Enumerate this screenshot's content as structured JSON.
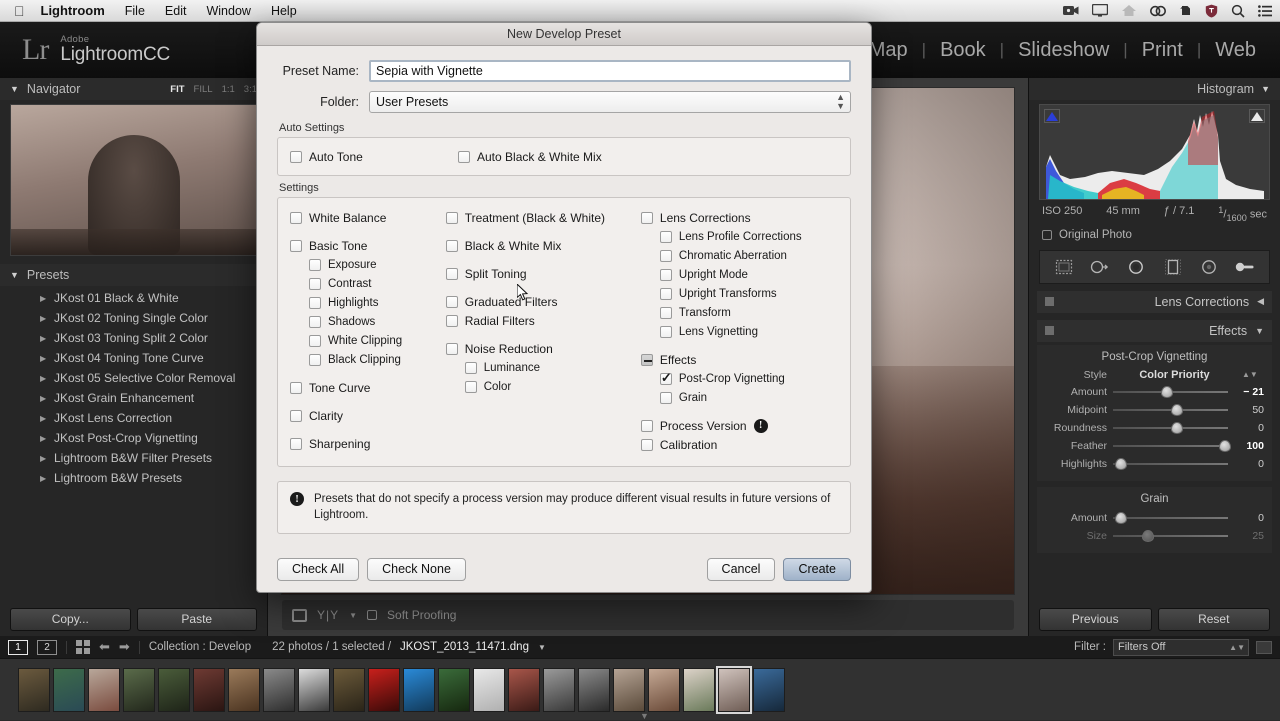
{
  "menubar": {
    "apple": "",
    "items": [
      "Lightroom",
      "File",
      "Edit",
      "Window",
      "Help"
    ],
    "status_icons": [
      "video-camera-icon",
      "display-icon",
      "dropbox-icon",
      "creative-cloud-icon",
      "evernote-icon",
      "shield-icon",
      "search-icon",
      "list-icon"
    ]
  },
  "app": {
    "brand_small": "Adobe",
    "brand_name": "LightroomCC",
    "logo": "Lr",
    "modules": [
      "Map",
      "Book",
      "Slideshow",
      "Print",
      "Web"
    ]
  },
  "navigator": {
    "title": "Navigator",
    "zoom_levels": [
      "FIT",
      "FILL",
      "1:1",
      "3:1"
    ],
    "active_zoom": "FIT"
  },
  "presets": {
    "title": "Presets",
    "items": [
      "JKost 01 Black & White",
      "JKost 02 Toning Single Color",
      "JKost 03 Toning Split 2 Color",
      "JKost 04 Toning Tone Curve",
      "JKost 05 Selective Color Removal",
      "JKost Grain Enhancement",
      "JKost Lens Correction",
      "JKost Post-Crop Vignetting",
      "Lightroom B&W Filter Presets",
      "Lightroom B&W Presets"
    ],
    "copy_label": "Copy...",
    "paste_label": "Paste"
  },
  "center": {
    "soft_proofing_label": "Soft Proofing"
  },
  "histogram": {
    "title": "Histogram",
    "iso": "ISO 250",
    "focal": "45 mm",
    "aperture": "ƒ / 7.1",
    "shutter_num": "1",
    "shutter_den": "1600",
    "shutter_unit": "sec",
    "original_photo": "Original Photo"
  },
  "panels": {
    "lens_corrections": "Lens Corrections",
    "effects": "Effects"
  },
  "effects": {
    "pcv_title": "Post-Crop Vignetting",
    "style_label": "Style",
    "style_value": "Color Priority",
    "sliders": [
      {
        "label": "Amount",
        "value": "− 21",
        "pos": 42,
        "bold": true
      },
      {
        "label": "Midpoint",
        "value": "50",
        "pos": 50,
        "bold": false
      },
      {
        "label": "Roundness",
        "value": "0",
        "pos": 50,
        "bold": false
      },
      {
        "label": "Feather",
        "value": "100",
        "pos": 92,
        "bold": true
      },
      {
        "label": "Highlights",
        "value": "0",
        "pos": 3,
        "bold": false
      }
    ],
    "grain_title": "Grain",
    "grain_sliders": [
      {
        "label": "Amount",
        "value": "0",
        "pos": 3,
        "dim": false
      },
      {
        "label": "Size",
        "value": "25",
        "pos": 25,
        "dim": true
      }
    ],
    "previous_label": "Previous",
    "reset_label": "Reset"
  },
  "toolbar": {
    "screen_1": "1",
    "screen_2": "2",
    "collection": "Collection : Develop",
    "photo_count": "22 photos / 1 selected /",
    "filename": "JKOST_2013_11471.dng",
    "filter_label": "Filter :",
    "filter_value": "Filters Off"
  },
  "dialog": {
    "title": "New Develop Preset",
    "preset_name_label": "Preset Name:",
    "preset_name_value": "Sepia with Vignette",
    "folder_label": "Folder:",
    "folder_value": "User Presets",
    "auto_settings_label": "Auto Settings",
    "auto_settings": [
      {
        "label": "Auto Tone",
        "state": "unchecked"
      },
      {
        "label": "Auto Black & White Mix",
        "state": "unchecked"
      }
    ],
    "settings_label": "Settings",
    "column1": [
      {
        "label": "White Balance",
        "state": "unchecked",
        "sub": false
      },
      {
        "label": "Basic Tone",
        "state": "unchecked",
        "sub": false,
        "gap_before": true
      },
      {
        "label": "Exposure",
        "state": "unchecked",
        "sub": true
      },
      {
        "label": "Contrast",
        "state": "unchecked",
        "sub": true
      },
      {
        "label": "Highlights",
        "state": "unchecked",
        "sub": true
      },
      {
        "label": "Shadows",
        "state": "unchecked",
        "sub": true
      },
      {
        "label": "White Clipping",
        "state": "unchecked",
        "sub": true
      },
      {
        "label": "Black Clipping",
        "state": "unchecked",
        "sub": true
      },
      {
        "label": "Tone Curve",
        "state": "unchecked",
        "sub": false,
        "gap_before": true
      },
      {
        "label": "Clarity",
        "state": "unchecked",
        "sub": false,
        "gap_before": true
      },
      {
        "label": "Sharpening",
        "state": "unchecked",
        "sub": false,
        "gap_before": true
      }
    ],
    "column2": [
      {
        "label": "Treatment (Black & White)",
        "state": "unchecked",
        "sub": false
      },
      {
        "label": "Black & White Mix",
        "state": "unchecked",
        "sub": false,
        "gap_before": true
      },
      {
        "label": "Split Toning",
        "state": "unchecked",
        "sub": false,
        "gap_before": true
      },
      {
        "label": "Graduated Filters",
        "state": "unchecked",
        "sub": false,
        "gap_before": true
      },
      {
        "label": "Radial Filters",
        "state": "unchecked",
        "sub": false
      },
      {
        "label": "Noise Reduction",
        "state": "unchecked",
        "sub": false,
        "gap_before": true
      },
      {
        "label": "Luminance",
        "state": "unchecked",
        "sub": true
      },
      {
        "label": "Color",
        "state": "unchecked",
        "sub": true
      }
    ],
    "column3": [
      {
        "label": "Lens Corrections",
        "state": "unchecked",
        "sub": false
      },
      {
        "label": "Lens Profile Corrections",
        "state": "unchecked",
        "sub": true
      },
      {
        "label": "Chromatic Aberration",
        "state": "unchecked",
        "sub": true
      },
      {
        "label": "Upright Mode",
        "state": "unchecked",
        "sub": true
      },
      {
        "label": "Upright Transforms",
        "state": "unchecked",
        "sub": true
      },
      {
        "label": "Transform",
        "state": "unchecked",
        "sub": true
      },
      {
        "label": "Lens Vignetting",
        "state": "unchecked",
        "sub": true
      },
      {
        "label": "Effects",
        "state": "mixed",
        "sub": false,
        "gap_before": true
      },
      {
        "label": "Post-Crop Vignetting",
        "state": "checked",
        "sub": true
      },
      {
        "label": "Grain",
        "state": "unchecked",
        "sub": true
      },
      {
        "label": "Process Version",
        "state": "unchecked",
        "sub": false,
        "gap_before": true,
        "badge": "!"
      },
      {
        "label": "Calibration",
        "state": "unchecked",
        "sub": false
      }
    ],
    "notice": "Presets that do not specify a process version may produce different visual results in future versions of Lightroom.",
    "notice_badge": "!",
    "check_all_label": "Check All",
    "check_none_label": "Check None",
    "cancel_label": "Cancel",
    "create_label": "Create"
  }
}
